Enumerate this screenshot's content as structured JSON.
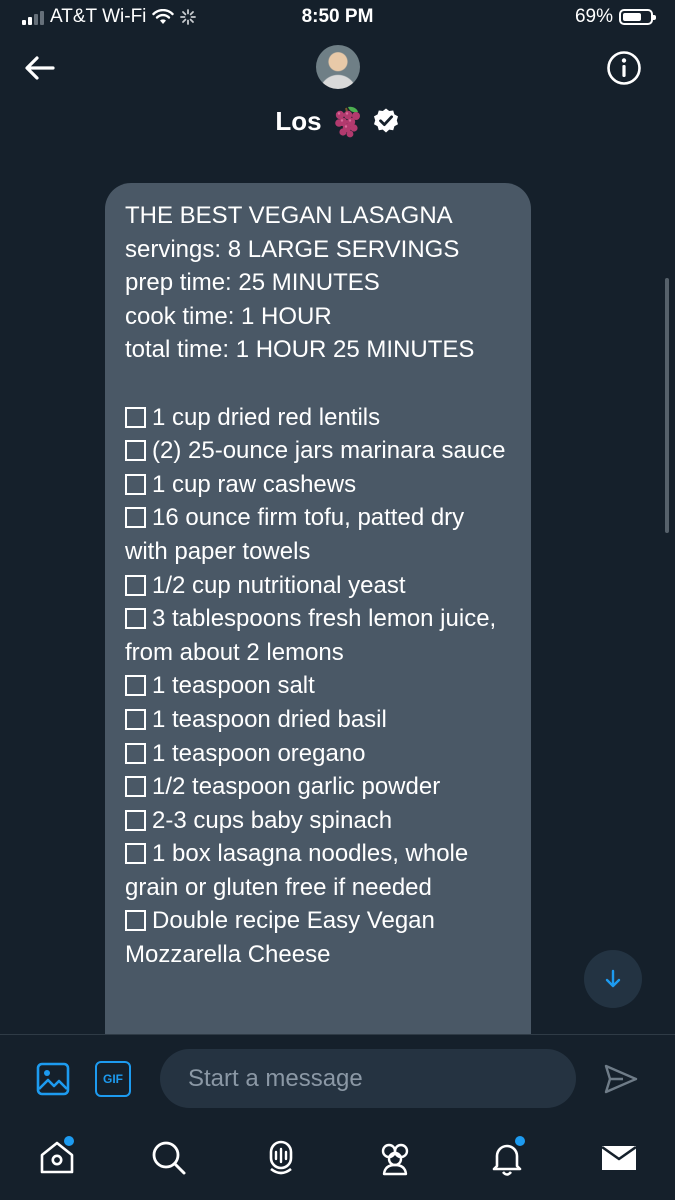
{
  "status_bar": {
    "carrier": "AT&T Wi-Fi",
    "time": "8:50 PM",
    "battery_text": "69%",
    "battery_level": 0.69
  },
  "header": {
    "contact_name": "Los",
    "back_icon": "back-arrow-icon",
    "info_icon": "info-icon",
    "emoji": "grapes",
    "verified": true
  },
  "message": {
    "title": "THE BEST VEGAN LASAGNA",
    "meta": [
      "servings: 8 LARGE SERVINGS",
      "prep time: 25 MINUTES",
      "cook time: 1 HOUR",
      "total time: 1 HOUR 25 MINUTES"
    ],
    "ingredients": [
      "1 cup dried red lentils",
      "(2) 25-ounce jars marinara sauce",
      "1 cup raw cashews",
      "16 ounce firm tofu, patted dry with paper towels",
      "1/2 cup nutritional yeast",
      "3 tablespoons fresh lemon juice, from about 2 lemons",
      "1 teaspoon salt",
      "1 teaspoon dried basil",
      "1 teaspoon oregano",
      "1/2 teaspoon garlic powder",
      "2-3 cups baby spinach",
      "1 box lasagna noodles, whole grain or gluten free if needed",
      "Double recipe Easy Vegan Mozzarella Cheese"
    ]
  },
  "composer": {
    "gif_label": "GIF",
    "placeholder": "Start a message"
  },
  "nav": {
    "items": [
      "home-icon",
      "search-icon",
      "spaces-icon",
      "communities-icon",
      "notifications-icon",
      "messages-icon"
    ]
  },
  "colors": {
    "background": "#15202b",
    "bubble": "#4a5866",
    "accent": "#1d9bf0",
    "input": "#253341",
    "placeholder": "#8b98a5"
  }
}
